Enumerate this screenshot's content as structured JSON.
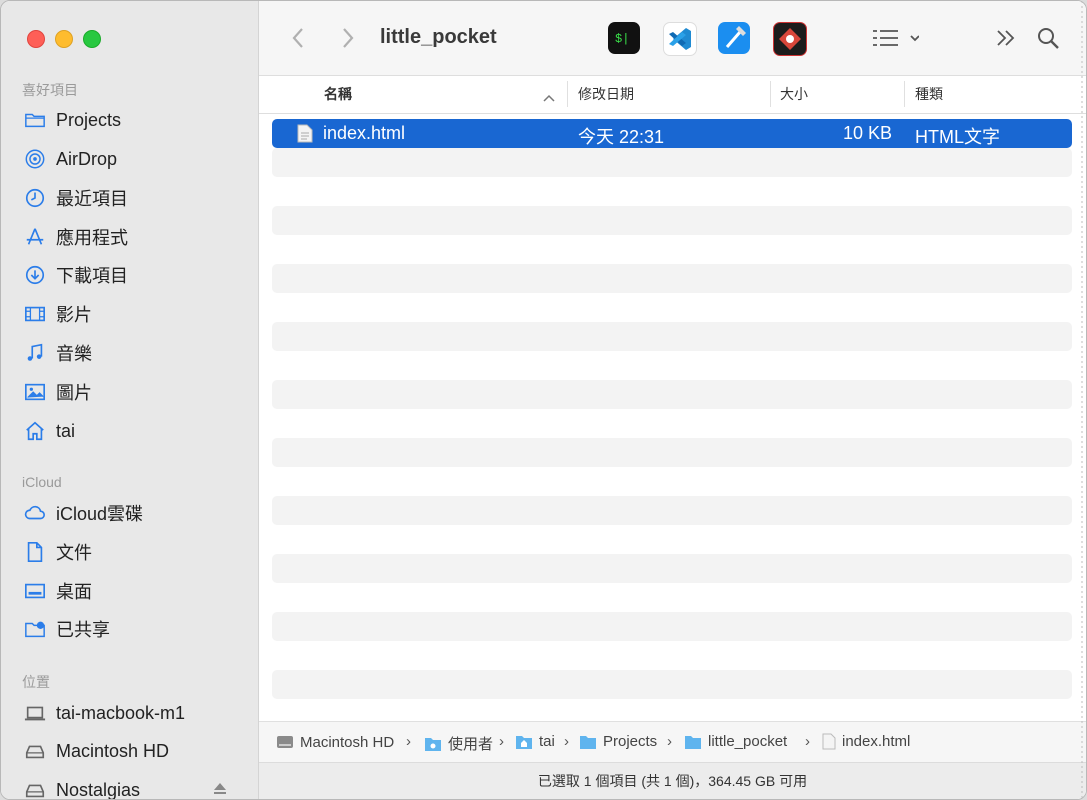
{
  "window": {
    "title": "little_pocket"
  },
  "sidebar": {
    "favorites_title": "喜好項目",
    "favorites": [
      {
        "label": "Projects",
        "icon": "folder-icon"
      },
      {
        "label": "AirDrop",
        "icon": "airdrop-icon"
      },
      {
        "label": "最近項目",
        "icon": "clock-icon"
      },
      {
        "label": "應用程式",
        "icon": "applications-icon"
      },
      {
        "label": "下載項目",
        "icon": "download-icon"
      },
      {
        "label": "影片",
        "icon": "film-icon"
      },
      {
        "label": "音樂",
        "icon": "music-icon"
      },
      {
        "label": "圖片",
        "icon": "photo-icon"
      },
      {
        "label": "tai",
        "icon": "home-icon"
      }
    ],
    "icloud_title": "iCloud",
    "icloud": [
      {
        "label": "iCloud雲碟",
        "icon": "cloud-icon"
      },
      {
        "label": "文件",
        "icon": "document-icon"
      },
      {
        "label": "桌面",
        "icon": "desktop-icon"
      },
      {
        "label": "已共享",
        "icon": "shared-folder-icon"
      }
    ],
    "locations_title": "位置",
    "locations": [
      {
        "label": "tai-macbook-m1",
        "icon": "laptop-icon"
      },
      {
        "label": "Macintosh HD",
        "icon": "disk-icon"
      },
      {
        "label": "Nostalgias",
        "icon": "disk-icon"
      }
    ]
  },
  "toolbar": {
    "apps": [
      "terminal-icon",
      "vscode-icon",
      "xcode-icon",
      "app-icon"
    ]
  },
  "columns": {
    "name": "名稱",
    "date": "修改日期",
    "size": "大小",
    "kind": "種類"
  },
  "files": [
    {
      "name": "index.html",
      "date": "今天 22:31",
      "size": "10 KB",
      "kind": "HTML文字",
      "selected": true
    }
  ],
  "pathbar": [
    "Macintosh HD",
    "使用者",
    "tai",
    "Projects",
    "little_pocket",
    "index.html"
  ],
  "status": "已選取 1 個項目 (共 1 個)，364.45 GB 可用",
  "colors": {
    "accent": "#1967d2",
    "sidebar_bg": "#e8e8e8"
  }
}
